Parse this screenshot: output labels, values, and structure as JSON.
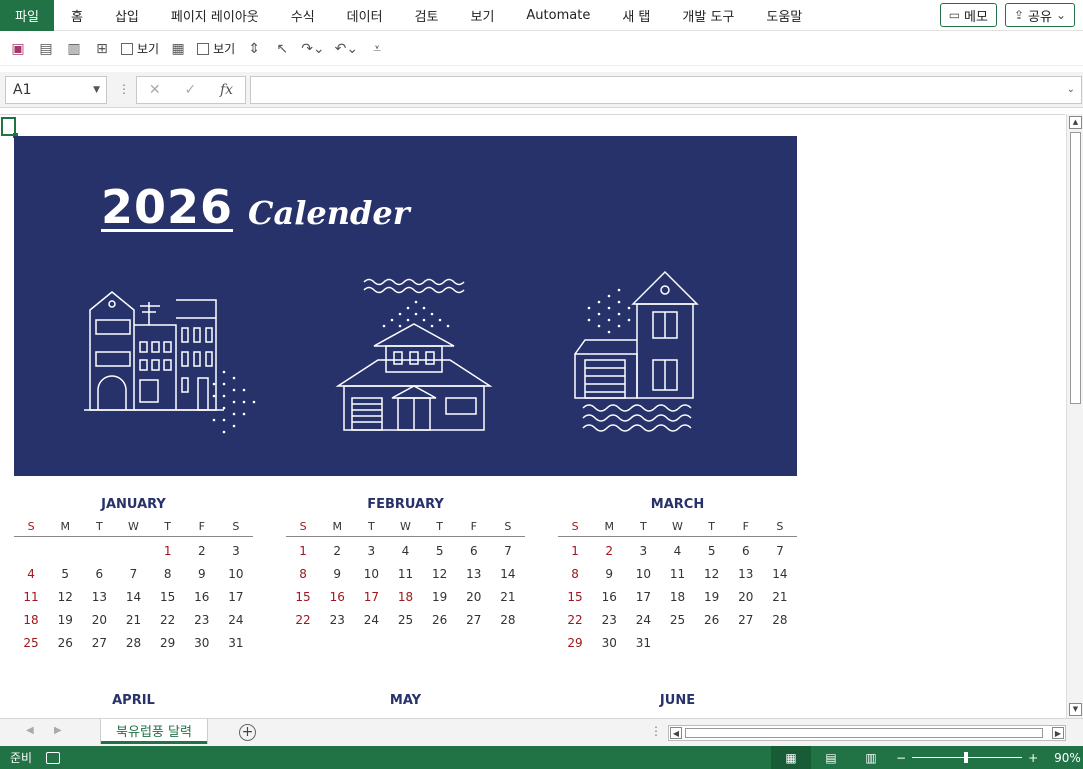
{
  "menu": {
    "file": "파일",
    "tabs": [
      "홈",
      "삽입",
      "페이지 레이아웃",
      "수식",
      "데이터",
      "검토",
      "보기",
      "Automate",
      "새 탭",
      "개발 도구",
      "도움말"
    ],
    "memo": "메모",
    "share": "공유"
  },
  "qat": {
    "view1": "보기",
    "view2": "보기"
  },
  "formula": {
    "namebox": "A1",
    "cancel": "✕",
    "enter": "✓",
    "fx": "fx",
    "value": ""
  },
  "banner": {
    "year": "2026",
    "title": "Calender"
  },
  "weekdays": [
    "S",
    "M",
    "T",
    "W",
    "T",
    "F",
    "S"
  ],
  "months": [
    {
      "name": "JANUARY",
      "cells": [
        "",
        "",
        "",
        "",
        "1",
        "2",
        "3",
        "4",
        "5",
        "6",
        "7",
        "8",
        "9",
        "10",
        "11",
        "12",
        "13",
        "14",
        "15",
        "16",
        "17",
        "18",
        "19",
        "20",
        "21",
        "22",
        "23",
        "24",
        "25",
        "26",
        "27",
        "28",
        "29",
        "30",
        "31"
      ],
      "red": [
        "1",
        "4",
        "11",
        "18",
        "25"
      ]
    },
    {
      "name": "FEBRUARY",
      "cells": [
        "1",
        "2",
        "3",
        "4",
        "5",
        "6",
        "7",
        "8",
        "9",
        "10",
        "11",
        "12",
        "13",
        "14",
        "15",
        "16",
        "17",
        "18",
        "19",
        "20",
        "21",
        "22",
        "23",
        "24",
        "25",
        "26",
        "27",
        "28"
      ],
      "red": [
        "1",
        "8",
        "15",
        "16",
        "17",
        "18",
        "22"
      ]
    },
    {
      "name": "MARCH",
      "cells": [
        "1",
        "2",
        "3",
        "4",
        "5",
        "6",
        "7",
        "8",
        "9",
        "10",
        "11",
        "12",
        "13",
        "14",
        "15",
        "16",
        "17",
        "18",
        "19",
        "20",
        "21",
        "22",
        "23",
        "24",
        "25",
        "26",
        "27",
        "28",
        "29",
        "30",
        "31"
      ],
      "red": [
        "1",
        "2",
        "8",
        "15",
        "22",
        "29"
      ]
    },
    {
      "name": "APRIL"
    },
    {
      "name": "MAY"
    },
    {
      "name": "JUNE"
    }
  ],
  "sheet_tab": "북유럽풍 달력",
  "status": {
    "ready": "준비",
    "zoom": "90%"
  },
  "colors": {
    "accent": "#217346",
    "banner": "#27316a",
    "holiday": "#a0161c"
  }
}
